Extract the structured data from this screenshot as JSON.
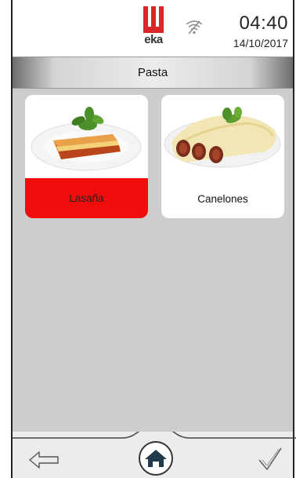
{
  "status": {
    "brand": "eka",
    "time": "04:40",
    "date": "14/10/2017",
    "wifi_icon": "wifi-off-icon"
  },
  "header": {
    "title": "Pasta"
  },
  "recipes": [
    {
      "label": "Lasaña",
      "selected": true,
      "image": "lasagna-photo"
    },
    {
      "label": "Canelones",
      "selected": false,
      "image": "cannelloni-photo"
    }
  ],
  "nav": {
    "back_icon": "arrow-left-icon",
    "home_icon": "home-icon",
    "confirm_icon": "checkmark-icon"
  },
  "colors": {
    "brand_red": "#d8262b",
    "selected_red": "#f20d0d",
    "content_bg": "#cdcdcd"
  }
}
